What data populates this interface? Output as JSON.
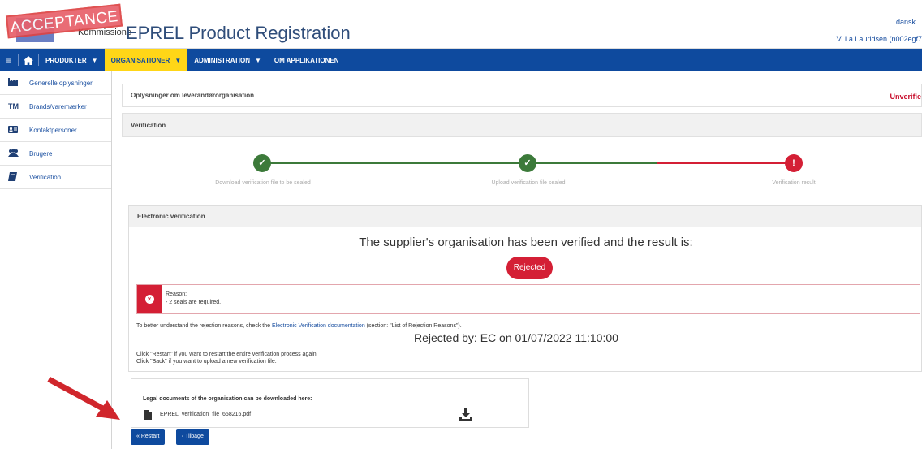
{
  "header": {
    "stamp": "ACCEPTANCE",
    "logo_text": "Kommissione",
    "app_title": "EPREL Product Registration",
    "language": "dansk",
    "user": "Vi La Lauridsen (n002egf7"
  },
  "navbar": {
    "items": [
      {
        "label": "PRODUKTER",
        "active": false
      },
      {
        "label": "ORGANISATIONER",
        "active": true
      },
      {
        "label": "ADMINISTRATION",
        "active": false
      },
      {
        "label": "OM APPLIKATIONEN",
        "active": false
      }
    ]
  },
  "sidebar": {
    "items": [
      {
        "label": "Generelle oplysninger",
        "icon": "factory-icon"
      },
      {
        "label": "Brands/varemærker",
        "icon": "trademark-icon"
      },
      {
        "label": "Kontaktpersoner",
        "icon": "contact-card-icon"
      },
      {
        "label": "Brugere",
        "icon": "users-icon"
      },
      {
        "label": "Verification",
        "icon": "book-icon"
      }
    ]
  },
  "main": {
    "org_info_title": "Oplysninger om leverandørorganisation",
    "status": "Unverifie",
    "verification_title": "Verification",
    "steps": [
      {
        "label": "Download verification file to be sealed",
        "state": "done"
      },
      {
        "label": "Upload verification file sealed",
        "state": "done"
      },
      {
        "label": "Verification result",
        "state": "error"
      }
    ],
    "electronic": {
      "title": "Electronic verification",
      "result_text": "The supplier's organisation has been verified and the result is:",
      "result_badge": "Rejected",
      "reason_title": "Reason:",
      "reason_items": [
        "-   2 seals are required."
      ],
      "info_prefix": "To better understand the rejection reasons, check the ",
      "info_link": "Electronic Verification documentation",
      "info_suffix": " (section: \"List of Rejection Reasons\").",
      "rejected_by": "Rejected by: EC on 01/07/2022 11:10:00",
      "restart_hint": "Click \"Restart\" if you want to restart the entire verification process again.",
      "back_hint": "Click \"Back\" if you want to upload a new verification file."
    },
    "docs": {
      "title": "Legal documents of the organisation can be downloaded here:",
      "file_name": "EPREL_verification_file_658216.pdf"
    },
    "buttons": {
      "restart": "« Restart",
      "back": "‹ Tilbage"
    }
  },
  "colors": {
    "navbar": "#0e4a9e",
    "active_nav": "#ffd617",
    "success": "#3c7a3a",
    "error": "#d41f35",
    "arrow": "#d0262c"
  }
}
